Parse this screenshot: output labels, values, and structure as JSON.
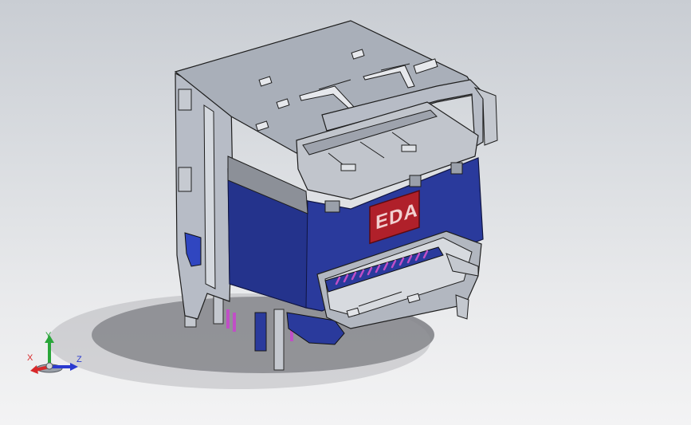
{
  "viewport": {
    "background_top": "#c9cdd3",
    "background_bottom": "#f3f3f4"
  },
  "model": {
    "logo_text": "EDA",
    "colors": {
      "metal_shell": "#b7bcc6",
      "metal_top": "#a9afb9",
      "housing_blue": "#2a3a9c",
      "housing_blue_dark": "#1f2c7e",
      "pins": "#c04fc6",
      "logo_red": "#b0202a"
    }
  },
  "triad": {
    "x_label": "X",
    "y_label": "Y",
    "z_label": "Z",
    "x_color": "#d8282a",
    "y_color": "#2aa63a",
    "z_color": "#2a3ad0"
  }
}
